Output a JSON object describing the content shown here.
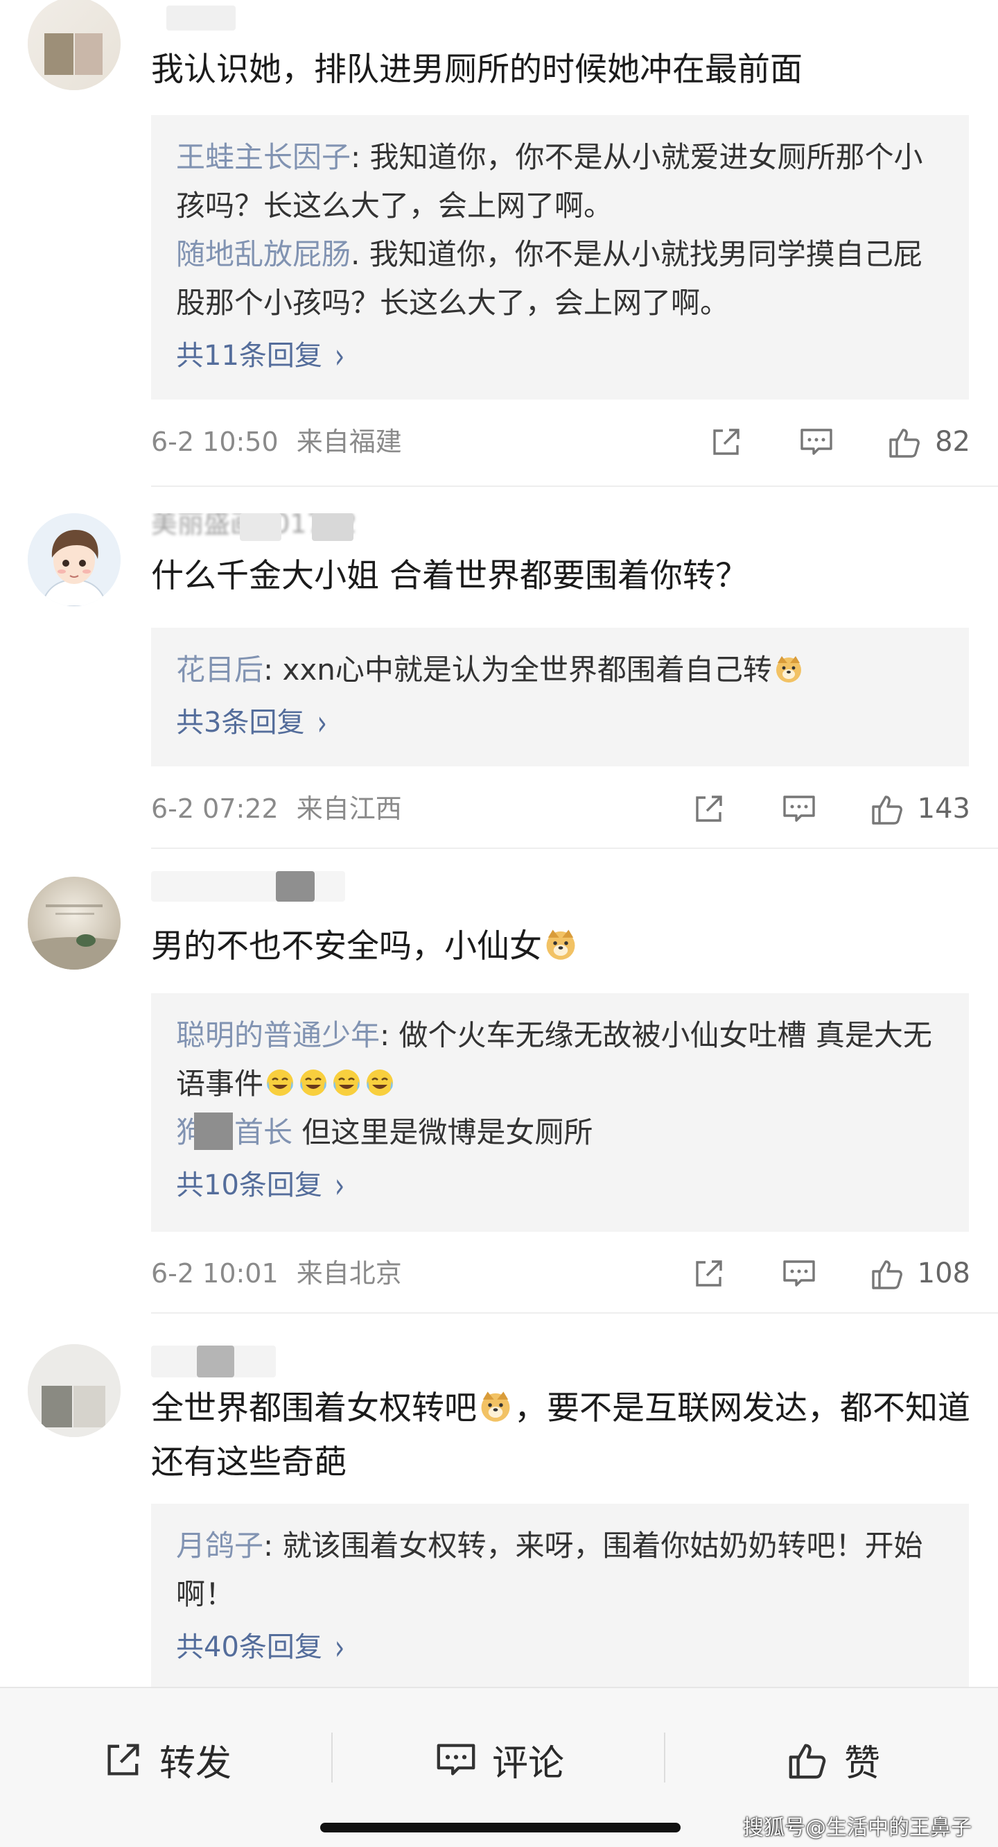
{
  "comments": [
    {
      "text": "我认识她，排队进男厕所的时候她冲在最前面",
      "replies": [
        {
          "name": "王蛙主长因子",
          "text": ": 我知道你，你不是从小就爱进女厕所那个小孩吗？长这么大了，会上网了啊。"
        },
        {
          "name": "随地乱放屁肠",
          "text": ". 我知道你，你不是从小就找男同学摸自己屁股那个小孩吗？长这么大了，会上网了啊。"
        }
      ],
      "more": "共11条回复",
      "date": "6-2 10:50",
      "location": "来自福建",
      "likes": "82"
    },
    {
      "username": "美丽盛画201712",
      "text": "什么千金大小姐 合着世界都要围着你转？",
      "replies": [
        {
          "name": "花目后",
          "text": ": xxn心中就是认为全世界都围着自己转",
          "emoji": "doge"
        }
      ],
      "more": "共3条回复",
      "date": "6-2 07:22",
      "location": "来自江西",
      "likes": "143"
    },
    {
      "text": "男的不也不安全吗，小仙女",
      "replies": [
        {
          "name": "聪明的普通少年",
          "text": ": 做个火车无缘无故被小仙女吐槽  真是大无语事件"
        },
        {
          "name": "狗狗首长",
          "text": " 但这里是微博是女厕所"
        }
      ],
      "more": "共10条回复",
      "date": "6-2 10:01",
      "location": "来自北京",
      "likes": "108"
    },
    {
      "text_a": "全世界都围着女权转吧",
      "text_b": "，要不是互联网发达，都不知道还有这些奇葩",
      "replies": [
        {
          "name": "月鸽子",
          "text": ": 就该围着女权转，来呀，围着你姑奶奶转吧！开始啊！"
        }
      ],
      "more": "共40条回复"
    }
  ],
  "bottom_bar": {
    "repost": "转发",
    "comment": "评论",
    "like": "赞"
  },
  "watermark": "搜狐号@生活中的王鼻子",
  "icons": {
    "share": "share-icon",
    "comment": "comment-icon",
    "like": "thumbs-up-icon",
    "chevron": "chevron-right-icon",
    "emoji_doge": "doge-emoji-icon",
    "emoji_laugh_cry": "laugh-cry-emoji-icon"
  },
  "colors": {
    "link": "#546d9b",
    "reply_name": "#8193b2",
    "reply_bg": "#f4f4f4",
    "meta": "#8a8a8a"
  }
}
